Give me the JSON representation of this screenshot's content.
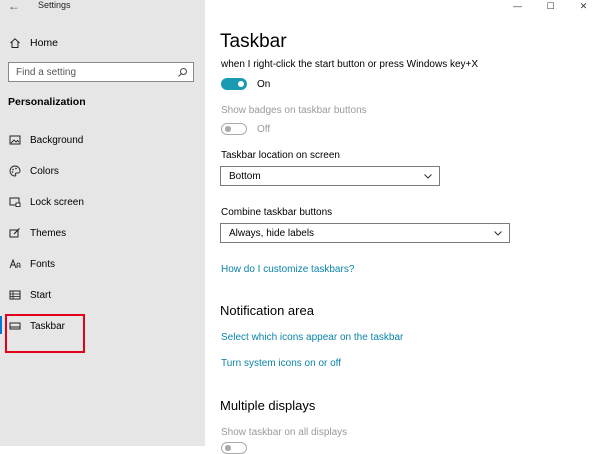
{
  "window": {
    "title": "Settings",
    "back_glyph": "←",
    "controls": {
      "minimize": "—",
      "maximize": "☐",
      "close": "✕"
    }
  },
  "sidebar": {
    "home_label": "Home",
    "search_placeholder": "Find a setting",
    "section_heading": "Personalization",
    "items": [
      {
        "label": "Background",
        "icon": "picture-icon"
      },
      {
        "label": "Colors",
        "icon": "palette-icon"
      },
      {
        "label": "Lock screen",
        "icon": "lock-screen-icon"
      },
      {
        "label": "Themes",
        "icon": "brush-icon"
      },
      {
        "label": "Fonts",
        "icon": "font-icon"
      },
      {
        "label": "Start",
        "icon": "start-grid-icon"
      },
      {
        "label": "Taskbar",
        "icon": "taskbar-icon",
        "selected": true
      }
    ]
  },
  "main": {
    "title": "Taskbar",
    "winx_description": "when I right-click the start button or press Windows key+X",
    "winx_toggle": {
      "state_label": "On",
      "on": true
    },
    "badges": {
      "label": "Show badges on taskbar buttons",
      "state_label": "Off",
      "on": false,
      "disabled": true
    },
    "location": {
      "label": "Taskbar location on screen",
      "value": "Bottom"
    },
    "combine": {
      "label": "Combine taskbar buttons",
      "value": "Always, hide labels"
    },
    "customize_link": "How do I customize taskbars?",
    "notification_area": {
      "heading": "Notification area",
      "links": [
        "Select which icons appear on the taskbar",
        "Turn system icons on or off"
      ]
    },
    "multiple_displays": {
      "heading": "Multiple displays",
      "show_all_label": "Show taskbar on all displays"
    }
  },
  "colors": {
    "accent": "#1a9bb3",
    "link": "#0a84a8",
    "highlight_border": "#e4001b",
    "sidebar_bg": "#e6e6e6"
  }
}
